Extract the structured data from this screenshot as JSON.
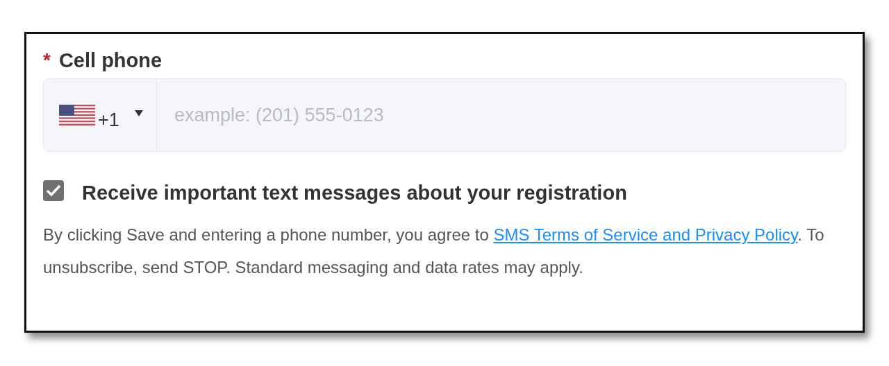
{
  "field": {
    "required_mark": "*",
    "label": "Cell phone",
    "country_code": "+1",
    "placeholder": "example: (201) 555-0123"
  },
  "consent": {
    "checked": true,
    "label": "Receive important text messages about your registration"
  },
  "notice": {
    "before": "By clicking Save and entering a phone number, you agree to ",
    "link": "SMS Terms of Service and Privacy Policy",
    "after": ". To unsubscribe, send STOP. Standard messaging and data rates may apply."
  }
}
